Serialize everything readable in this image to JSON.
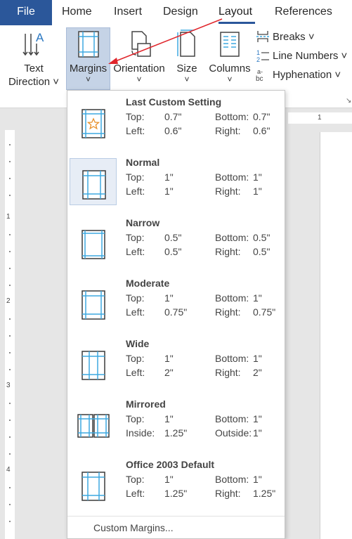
{
  "tabs": {
    "file": "File",
    "home": "Home",
    "insert": "Insert",
    "design": "Design",
    "layout": "Layout",
    "references": "References"
  },
  "ribbon": {
    "text_direction": {
      "line1": "Text",
      "line2": "Direction ˅"
    },
    "margins": {
      "label": "Margins",
      "chevron": "˅"
    },
    "orientation": {
      "label": "Orientation",
      "chevron": "˅"
    },
    "size": {
      "label": "Size",
      "chevron": "˅"
    },
    "columns": {
      "label": "Columns",
      "chevron": "˅"
    },
    "breaks": "Breaks ˅",
    "line_numbers": "Line Numbers ˅",
    "hyphenation": "Hyphenation ˅"
  },
  "ruler": {
    "vertical_numbers": [
      "1",
      "2",
      "3",
      "4"
    ],
    "horizontal_number": "1"
  },
  "margins_menu": {
    "items": [
      {
        "name": "Last Custom Setting",
        "k1": "Top:",
        "v1": "0.7\"",
        "k2": "Bottom:",
        "v2": "0.7\"",
        "k3": "Left:",
        "v3": "0.6\"",
        "k4": "Right:",
        "v4": "0.6\""
      },
      {
        "name": "Normal",
        "k1": "Top:",
        "v1": "1\"",
        "k2": "Bottom:",
        "v2": "1\"",
        "k3": "Left:",
        "v3": "1\"",
        "k4": "Right:",
        "v4": "1\""
      },
      {
        "name": "Narrow",
        "k1": "Top:",
        "v1": "0.5\"",
        "k2": "Bottom:",
        "v2": "0.5\"",
        "k3": "Left:",
        "v3": "0.5\"",
        "k4": "Right:",
        "v4": "0.5\""
      },
      {
        "name": "Moderate",
        "k1": "Top:",
        "v1": "1\"",
        "k2": "Bottom:",
        "v2": "1\"",
        "k3": "Left:",
        "v3": "0.75\"",
        "k4": "Right:",
        "v4": "0.75\""
      },
      {
        "name": "Wide",
        "k1": "Top:",
        "v1": "1\"",
        "k2": "Bottom:",
        "v2": "1\"",
        "k3": "Left:",
        "v3": "2\"",
        "k4": "Right:",
        "v4": "2\""
      },
      {
        "name": "Mirrored",
        "k1": "Top:",
        "v1": "1\"",
        "k2": "Bottom:",
        "v2": "1\"",
        "k3": "Inside:",
        "v3": "1.25\"",
        "k4": "Outside:",
        "v4": "1\""
      },
      {
        "name": "Office 2003 Default",
        "k1": "Top:",
        "v1": "1\"",
        "k2": "Bottom:",
        "v2": "1\"",
        "k3": "Left:",
        "v3": "1.25\"",
        "k4": "Right:",
        "v4": "1.25\""
      }
    ],
    "custom_margins": "Custom Margins..."
  },
  "colors": {
    "accent": "#2b579a",
    "margin_line": "#3da9e0",
    "annotation_arrow": "#e0252b",
    "custom_star": "#e8902a"
  }
}
